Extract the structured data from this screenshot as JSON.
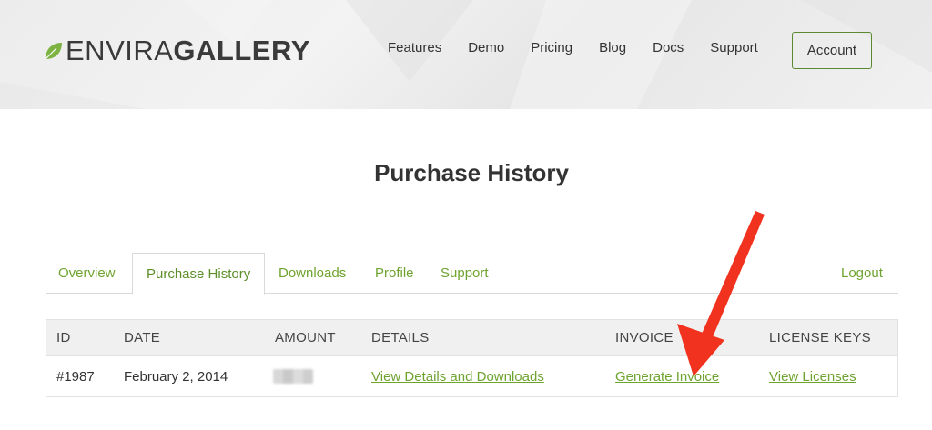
{
  "header": {
    "logo": {
      "light": "ENVIRA",
      "bold": "GALLERY"
    },
    "nav": [
      {
        "label": "Features"
      },
      {
        "label": "Demo"
      },
      {
        "label": "Pricing"
      },
      {
        "label": "Blog"
      },
      {
        "label": "Docs"
      },
      {
        "label": "Support"
      }
    ],
    "account_label": "Account"
  },
  "page": {
    "title": "Purchase History"
  },
  "tabs": [
    {
      "label": "Overview",
      "active": false
    },
    {
      "label": "Purchase History",
      "active": true
    },
    {
      "label": "Downloads",
      "active": false
    },
    {
      "label": "Profile",
      "active": false
    },
    {
      "label": "Support",
      "active": false
    },
    {
      "label": "Logout",
      "active": false
    }
  ],
  "table": {
    "columns": [
      "ID",
      "DATE",
      "AMOUNT",
      "DETAILS",
      "INVOICE",
      "LICENSE KEYS"
    ],
    "rows": [
      {
        "id": "#1987",
        "date": "February 2, 2014",
        "amount": "",
        "details": "View Details and Downloads",
        "invoice": "Generate Invoice",
        "license": "View Licenses"
      }
    ]
  },
  "colors": {
    "accent": "#6fa32f",
    "button_border": "#5a8a2f",
    "arrow": "#f0321e"
  },
  "icons": {
    "logo": "leaf-icon",
    "annotation": "red-arrow-icon"
  }
}
